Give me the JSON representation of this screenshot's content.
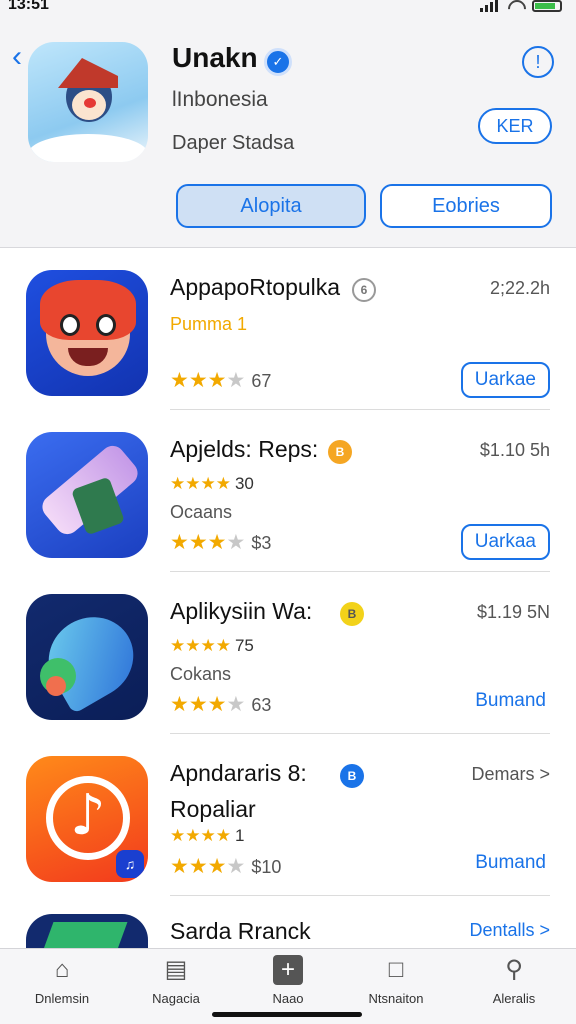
{
  "status_bar": {
    "time": "13:51"
  },
  "header": {
    "title": "Unakn",
    "region": "lInbonesia",
    "developer": "Daper Stadsa",
    "get_label": "KER",
    "segments": [
      "Alopita",
      "Eobries"
    ]
  },
  "apps": [
    {
      "title": "AppapoRtopulka",
      "badge": "6",
      "price": "2;22.2h",
      "sub1": "Pumma 1",
      "stars_count": "67",
      "action": "Uarkae",
      "action_style": "button"
    },
    {
      "title": "Apjelds: Reps:",
      "badge": "B",
      "price": "$1.10 5h",
      "small_stars_count": "30",
      "sub2": "Ocaans",
      "stars_count": "$3",
      "action": "Uarkaa",
      "action_style": "button"
    },
    {
      "title": "Aplikysiin Wa:",
      "badge": "B",
      "price": "$1.19 5N",
      "small_stars_count": "75",
      "sub2": "Cokans",
      "stars_count": "63",
      "action": "Bumand",
      "action_style": "text"
    },
    {
      "title": "Apndararis 8:",
      "badge": "B",
      "price": "Demars >",
      "sub1": "Ropaliar",
      "small_stars_count": "1",
      "stars_count": "$10",
      "action": "Bumand",
      "action_style": "text"
    },
    {
      "title": "Sarda Rranck",
      "price": "Dentalls >"
    }
  ],
  "tab_bar": {
    "tabs": [
      {
        "label": "Dnlemsin",
        "icon": "home-icon"
      },
      {
        "label": "Nagacia",
        "icon": "news-icon"
      },
      {
        "label": "Naao",
        "icon": "add-icon"
      },
      {
        "label": "Ntsnaiton",
        "icon": "calendar-icon"
      },
      {
        "label": "Aleralis",
        "icon": "search-icon"
      }
    ]
  },
  "colors": {
    "accent": "#1a73e8",
    "star": "#f2a900"
  }
}
